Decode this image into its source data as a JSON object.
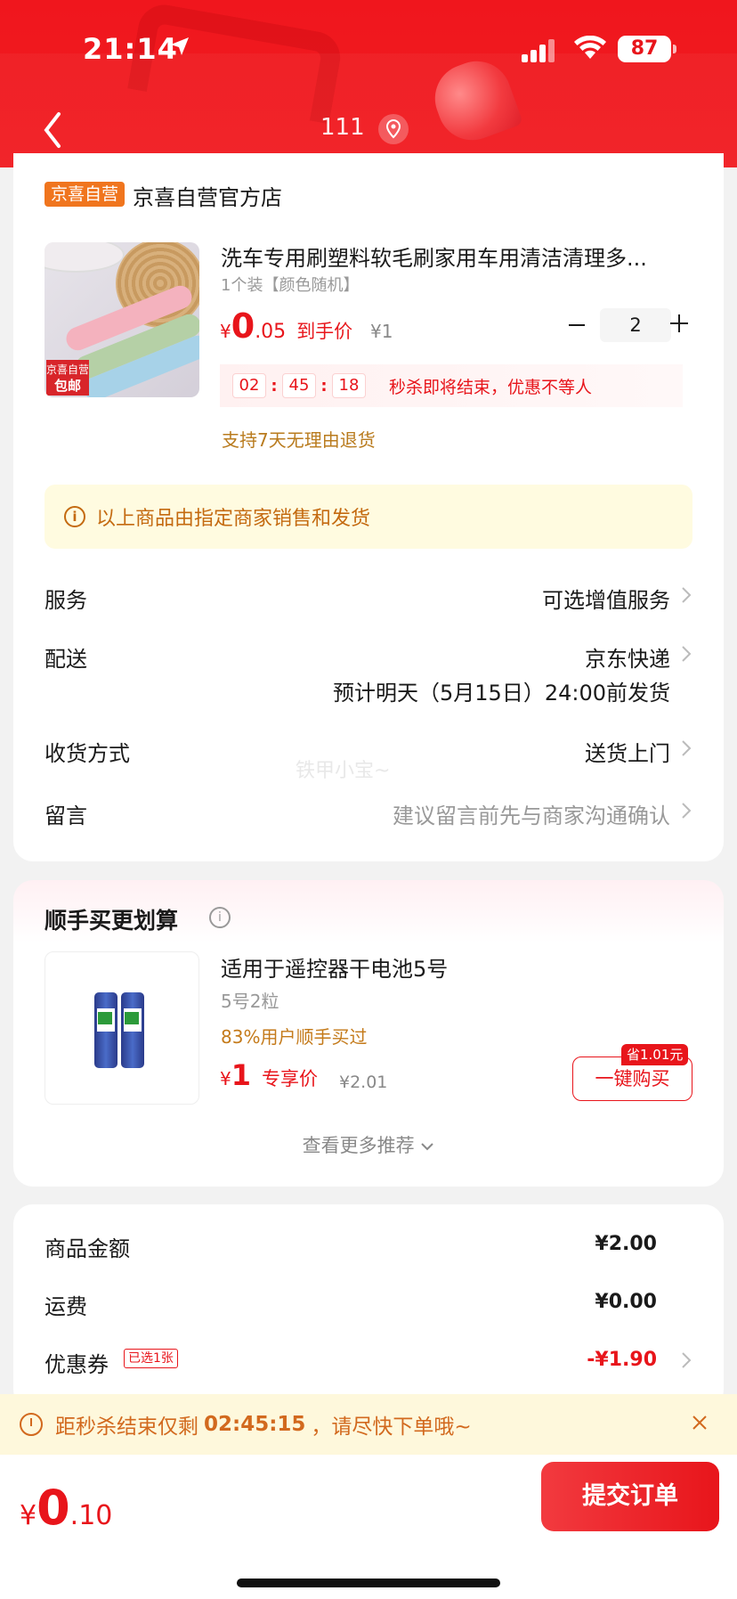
{
  "status_bar": {
    "time": "21:14",
    "battery": "87"
  },
  "nav": {
    "title": "111"
  },
  "shop": {
    "badge": "京喜自营",
    "name": "京喜自营官方店"
  },
  "product": {
    "title": "洗车专用刷塑料软毛刷家用车用清洁清理多...",
    "spec": "1个装【颜色随机】",
    "image_tag_top": "京喜自营",
    "image_tag_bottom": "包邮",
    "price_symbol": "¥",
    "price_int": "0",
    "price_dec": ".05",
    "price_label": "到手价",
    "old_price": "¥1",
    "quantity": "2",
    "countdown": {
      "h": "02",
      "m": "45",
      "s": "18",
      "sep": ":"
    },
    "flash_text": "秒杀即将结束，优惠不等人",
    "return_policy": "支持7天无理由退货"
  },
  "notice": {
    "icon": "i",
    "text": "以上商品由指定商家销售和发货"
  },
  "rows": {
    "service": {
      "label": "服务",
      "value": "可选增值服务"
    },
    "delivery": {
      "label": "配送",
      "value": "京东快递",
      "sub": "预计明天（5月15日）24:00前发货"
    },
    "receive": {
      "label": "收货方式",
      "value": "送货上门"
    },
    "message": {
      "label": "留言",
      "value": "建议留言前先与商家沟通确认"
    }
  },
  "watermark": "铁甲小宝~",
  "recommend": {
    "title": "顺手买更划算",
    "info_icon": "i",
    "item_title": "适用于遥控器干电池5号",
    "item_spec": "5号2粒",
    "item_bought": "83%用户顺手买过",
    "price_symbol": "¥",
    "price_int": "1",
    "price_label": "专享价",
    "old_price": "¥2.01",
    "save_tag": "省1.01元",
    "buy_label": "一键购买",
    "more_label": "查看更多推荐"
  },
  "summary": {
    "goods_label": "商品金额",
    "goods_value": "¥2.00",
    "shipping_label": "运费",
    "shipping_value": "¥0.00",
    "coupon_label": "优惠券",
    "coupon_tag": "已选1张",
    "coupon_value": "-¥1.90"
  },
  "banner": {
    "prefix": "距秒杀结束仅剩",
    "time": "02:45:15",
    "suffix": "，请尽快下单哦~"
  },
  "bottom": {
    "price_symbol": "¥",
    "price_int": "0",
    "price_dec": ".10",
    "submit_label": "提交订单"
  },
  "colors": {
    "brand_red": "#e8151b",
    "header_red": "#f0161d",
    "notice_bg": "#fffbe0",
    "accent_orange": "#f0751e"
  }
}
